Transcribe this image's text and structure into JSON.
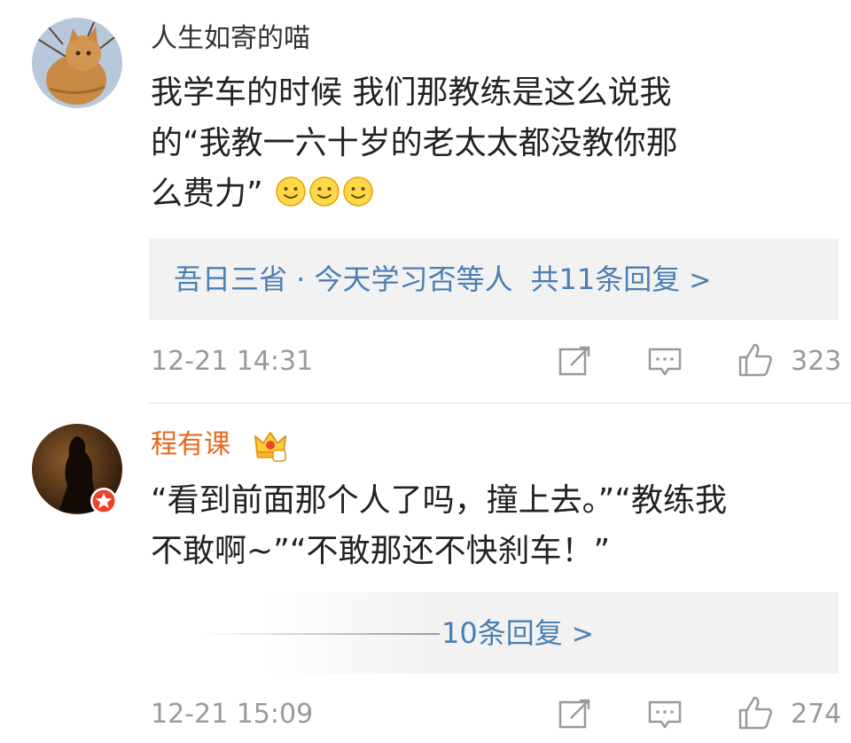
{
  "comments": [
    {
      "username": "人生如寄的喵",
      "text_lines": [
        "我学车的时候 我们那教练是这么说我",
        "的“我教一六十岁的老太太都没教你那",
        "么费力”"
      ],
      "emoji_icon": "smile-emoji",
      "reply_users": "吾日三省 · 今天学习否等人",
      "reply_count": "共11条回复",
      "time": "12-21 14:31",
      "likes": "323"
    },
    {
      "username": "程有课",
      "text_lines": [
        "“看到前面那个人了吗，撞上去。”“教练我",
        "不敢啊~”“不敢那还不快刹车！”"
      ],
      "reply_count": "10条回复",
      "time": "12-21 15:09",
      "likes": "274"
    }
  ],
  "colors": {
    "username_default": "#333333",
    "username_vip": "#e8671b",
    "link": "#4a7fb3",
    "meta": "#9a9a9a"
  }
}
